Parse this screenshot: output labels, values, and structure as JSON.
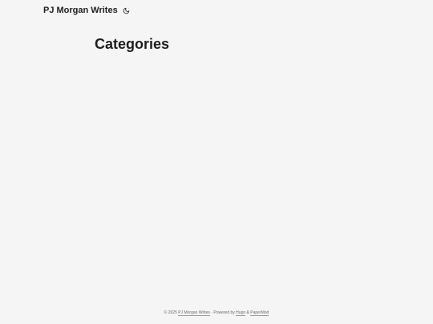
{
  "header": {
    "site_title": "PJ Morgan Writes",
    "theme_toggle_icon": "moon-icon"
  },
  "main": {
    "title": "Categories"
  },
  "footer": {
    "copyright": "© 2025",
    "site_link": "PJ Morgan Writes",
    "powered_by": "· Powered by",
    "hugo_link": "Hugo",
    "amp": "&",
    "theme_link": "PaperMod"
  },
  "colors": {
    "background": "#f5f5f5",
    "text": "#1e1e1e",
    "muted": "#6b6b6b"
  }
}
